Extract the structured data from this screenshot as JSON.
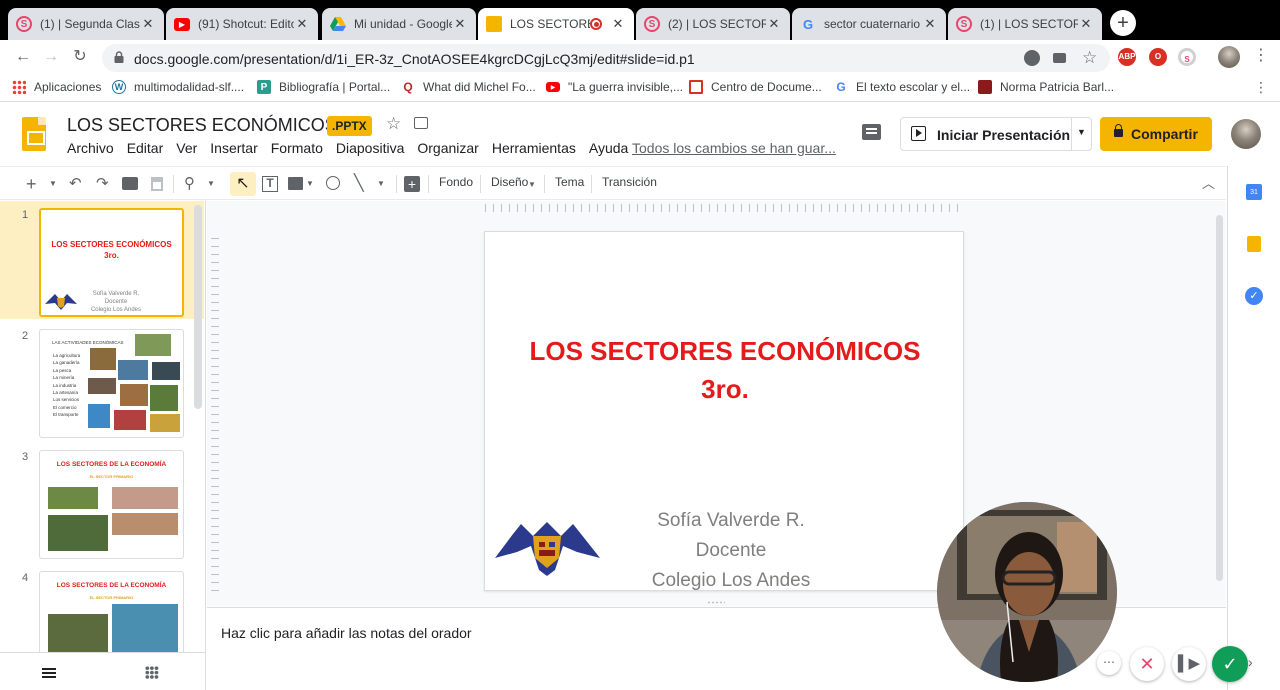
{
  "browser": {
    "tabs": [
      {
        "title": "(1) | Segunda Clase",
        "icon": "onda-icon"
      },
      {
        "title": "(91) Shotcut: Editor",
        "icon": "youtube-icon"
      },
      {
        "title": "Mi unidad - Google",
        "icon": "google-drive-icon"
      },
      {
        "title": "LOS SECTORES",
        "icon": "google-slides-icon",
        "active": true,
        "recording": true
      },
      {
        "title": "(2) | LOS SECTORES",
        "icon": "onda-icon"
      },
      {
        "title": "sector cuaternario",
        "icon": "google-icon"
      },
      {
        "title": "(1) | LOS SECTORES",
        "icon": "onda-icon"
      }
    ],
    "url": "docs.google.com/presentation/d/1i_ER-3z_CnotAOSEE4kgrcDCgjLcQ3mj/edit#slide=id.p1",
    "bookmarks": [
      {
        "label": "Aplicaciones",
        "icon": "apps-grid-icon"
      },
      {
        "label": "multimodalidad-slf....",
        "icon": "wordpress-icon"
      },
      {
        "label": "Bibliografía | Portal...",
        "icon": "portal-icon"
      },
      {
        "label": "What did Michel Fo...",
        "icon": "quora-icon"
      },
      {
        "label": "\"La guerra invisible,...",
        "icon": "youtube-icon"
      },
      {
        "label": "Centro de Docume...",
        "icon": "docs-center-icon"
      },
      {
        "label": "El texto escolar y el...",
        "icon": "google-icon"
      },
      {
        "label": "Norma Patricia Barl...",
        "icon": "profile-icon"
      }
    ],
    "extensions": [
      {
        "name": "translate-icon"
      },
      {
        "name": "camera-icon"
      },
      {
        "name": "bookmark-star-icon"
      },
      {
        "name": "adblock-icon",
        "label": "ABP"
      },
      {
        "name": "opera-icon"
      },
      {
        "name": "onda-icon"
      }
    ]
  },
  "doc": {
    "title": "LOS SECTORES ECONÓMICOS 3",
    "badge": ".PPTX",
    "menu": [
      "Archivo",
      "Editar",
      "Ver",
      "Insertar",
      "Formato",
      "Diapositiva",
      "Organizar",
      "Herramientas",
      "Ayuda"
    ],
    "saved_note": "Todos los cambios se han guar...",
    "present_label": "Iniciar Presentación",
    "share_label": "Compartir"
  },
  "toolbar": {
    "fondo": "Fondo",
    "diseno": "Diseño",
    "tema": "Tema",
    "transicion": "Transición"
  },
  "filmstrip": [
    {
      "num": "1",
      "title": "LOS SECTORES  ECONÓMICOS",
      "subtitle": "3ro.",
      "author": [
        "Sofía Valverde R.",
        "Docente",
        "Colegio Los Andes"
      ]
    },
    {
      "num": "2",
      "heading": "LAS ACTIVIDADES ECONÓMICAS",
      "items": [
        "La agricultura",
        "La ganadería",
        "La pesca",
        "La minería",
        "La industria",
        "La artesanía",
        "Los servicios",
        "El comercio",
        "El transporte"
      ]
    },
    {
      "num": "3",
      "title": "LOS SECTORES DE LA ECONOMÍA",
      "subtitle": "EL SECTOR PRIMARIO"
    },
    {
      "num": "4",
      "title": "LOS SECTORES DE LA ECONOMÍA",
      "subtitle": "EL SECTOR PRIMARIO"
    }
  ],
  "slide": {
    "title_line1": "LOS SECTORES  ECONÓMICOS",
    "title_line2": "3ro.",
    "author_name": "Sofía Valverde R.",
    "author_role": "Docente",
    "author_school": "Colegio Los Andes"
  },
  "notes_placeholder": "Haz clic para añadir las notas del orador",
  "colors": {
    "accent": "#f4b400",
    "slide_title": "#e51a1a",
    "author_text": "#7f7f7f",
    "logo_blue": "#2b3a8c",
    "logo_gold": "#e0a21a"
  }
}
